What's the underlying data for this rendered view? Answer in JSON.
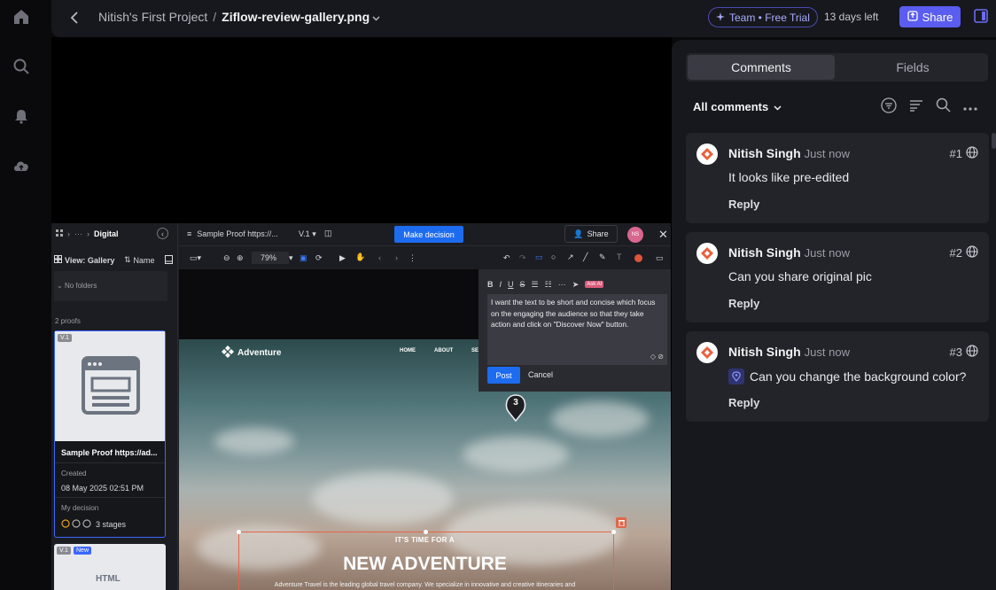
{
  "header": {
    "project": "Nitish's First Project",
    "separator": "/",
    "file": "Ziflow-review-gallery.png",
    "trial_label": "Team • Free Trial",
    "days_left": "13 days left",
    "share_label": "Share"
  },
  "embed": {
    "breadcrumb_folder": "Digital",
    "ellipsis": "···",
    "view_label": "View: Gallery",
    "sort_label": "Name",
    "no_folders": "No folders",
    "proofs_count": "2 proofs",
    "card1": {
      "version": "V.1",
      "title": "Sample Proof https://ad...",
      "created_label": "Created",
      "created_value": "08 May 2025 02:51 PM",
      "decision_label": "My decision",
      "stages": "3 stages"
    },
    "card2": {
      "version": "V.1",
      "badge": "New",
      "thumb_text": "HTML"
    },
    "proof_title": "Sample Proof https://...",
    "version_select": "V.1",
    "make_decision": "Make decision",
    "share_label": "Share",
    "avatar_initials": "NS",
    "zoom": "79%",
    "comment_draft": "I want the text to be short and concise which focus on the engaging the audience so that they take action and click on \"Discover Now\" button.",
    "ask_ai": "Ask AI",
    "post_label": "Post",
    "cancel_label": "Cancel",
    "pin_number": "3",
    "site": {
      "brand": "Adventure",
      "nav": [
        "HOME",
        "ABOUT",
        "SE"
      ],
      "kicker": "IT'S TIME FOR A",
      "headline": "NEW ADVENTURE",
      "para": "Adventure Travel is the leading global travel company. We specialize in innovative and creative itineraries and"
    }
  },
  "panel": {
    "tabs": [
      "Comments",
      "Fields"
    ],
    "filter_label": "All comments",
    "comments": [
      {
        "author": "Nitish Singh",
        "time": "Just now",
        "num": "#1",
        "text": "It looks like pre-edited",
        "reply": "Reply"
      },
      {
        "author": "Nitish Singh",
        "time": "Just now",
        "num": "#2",
        "text": "Can you share original pic",
        "reply": "Reply"
      },
      {
        "author": "Nitish Singh",
        "time": "Just now",
        "num": "#3",
        "text": "Can you change the background color?",
        "reply": "Reply"
      }
    ]
  },
  "colors": {
    "accent": "#5b5cf0",
    "primary_blue": "#1d6cf0",
    "panel_bg": "#17181d",
    "card_bg": "#23242a"
  }
}
